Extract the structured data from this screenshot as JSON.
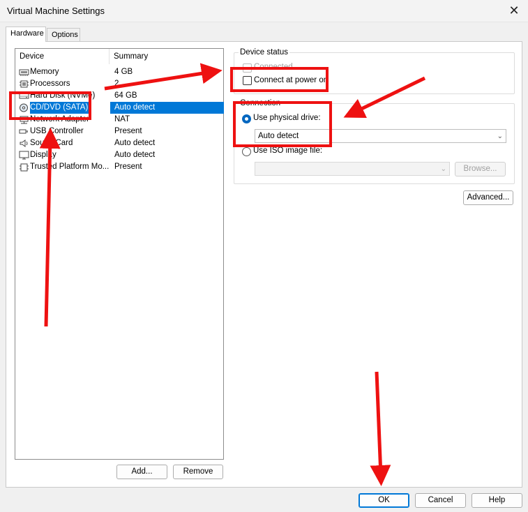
{
  "window": {
    "title": "Virtual Machine Settings",
    "close_glyph": "✕"
  },
  "tabs": [
    {
      "label": "Hardware",
      "active": true
    },
    {
      "label": "Options",
      "active": false
    }
  ],
  "device_list": {
    "headers": {
      "device": "Device",
      "summary": "Summary"
    },
    "rows": [
      {
        "icon": "memory-icon",
        "device": "Memory",
        "summary": "4 GB",
        "selected": false
      },
      {
        "icon": "processor-icon",
        "device": "Processors",
        "summary": "2",
        "selected": false
      },
      {
        "icon": "hard-disk-icon",
        "device": "Hard Disk (NVMe)",
        "summary": "64 GB",
        "selected": false
      },
      {
        "icon": "cd-dvd-icon",
        "device": "CD/DVD (SATA)",
        "summary": "Auto detect",
        "selected": true
      },
      {
        "icon": "network-adapter-icon",
        "device": "Network Adapter",
        "summary": "NAT",
        "selected": false
      },
      {
        "icon": "usb-icon",
        "device": "USB Controller",
        "summary": "Present",
        "selected": false
      },
      {
        "icon": "sound-card-icon",
        "device": "Sound Card",
        "summary": "Auto detect",
        "selected": false
      },
      {
        "icon": "display-icon",
        "device": "Display",
        "summary": "Auto detect",
        "selected": false
      },
      {
        "icon": "tpm-icon",
        "device": "Trusted Platform Mo...",
        "summary": "Present",
        "selected": false
      }
    ]
  },
  "list_buttons": {
    "add": "Add...",
    "remove": "Remove"
  },
  "device_status": {
    "title": "Device status",
    "connected_label": "Connected",
    "connected_checked": false,
    "connect_at_power_on_label": "Connect at power on",
    "connect_at_power_on_checked": false
  },
  "connection": {
    "title": "Connection",
    "use_physical_drive_label": "Use physical drive:",
    "physical_drive_value": "Auto detect",
    "use_iso_label": "Use ISO image file:",
    "iso_value": "",
    "browse_label": "Browse..."
  },
  "advanced_label": "Advanced...",
  "footer": {
    "ok": "OK",
    "cancel": "Cancel",
    "help": "Help"
  },
  "colors": {
    "selection": "#0078d7",
    "annotation": "#ee1111",
    "radio_accent": "#0067c0"
  }
}
